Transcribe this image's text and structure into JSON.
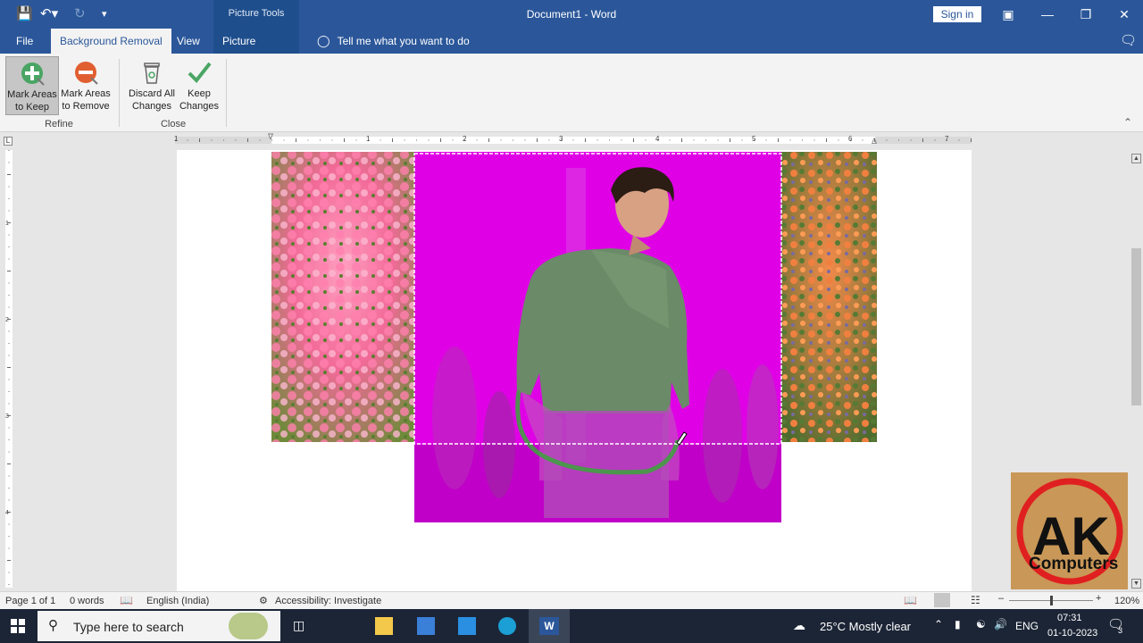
{
  "window": {
    "title": "Document1 - Word",
    "tools_header": "Picture Tools",
    "sign_in": "Sign in"
  },
  "tabs": {
    "file": "File",
    "background_removal": "Background Removal",
    "view": "View",
    "picture_format": "Picture Format",
    "tell_me": "Tell me what you want to do"
  },
  "ribbon": {
    "mark_keep": [
      "Mark Areas",
      "to Keep"
    ],
    "mark_remove": [
      "Mark Areas",
      "to Remove"
    ],
    "discard": [
      "Discard All",
      "Changes"
    ],
    "keep": [
      "Keep",
      "Changes"
    ],
    "group_refine": "Refine",
    "group_close": "Close"
  },
  "ruler": {
    "h_numbers": [
      "1",
      "1",
      "2",
      "3",
      "4",
      "5",
      "6",
      "7"
    ],
    "v_numbers": [
      "1",
      "2",
      "3",
      "4",
      "5"
    ],
    "corner": "L"
  },
  "logo": {
    "letters": "AK",
    "text": "Computers"
  },
  "status": {
    "page": "Page 1 of 1",
    "words": "0 words",
    "language": "English (India)",
    "accessibility": "Accessibility: Investigate",
    "zoom": "120%"
  },
  "taskbar": {
    "search_placeholder": "Type here to search",
    "weather": "25°C  Mostly clear",
    "lang": "ENG",
    "time": "07:31",
    "date": "01-10-2023",
    "notif_count": "3"
  },
  "colors": {
    "word_blue": "#2b579a",
    "magenta_mask": "#d800d8",
    "taskbar": "#1c2536"
  }
}
